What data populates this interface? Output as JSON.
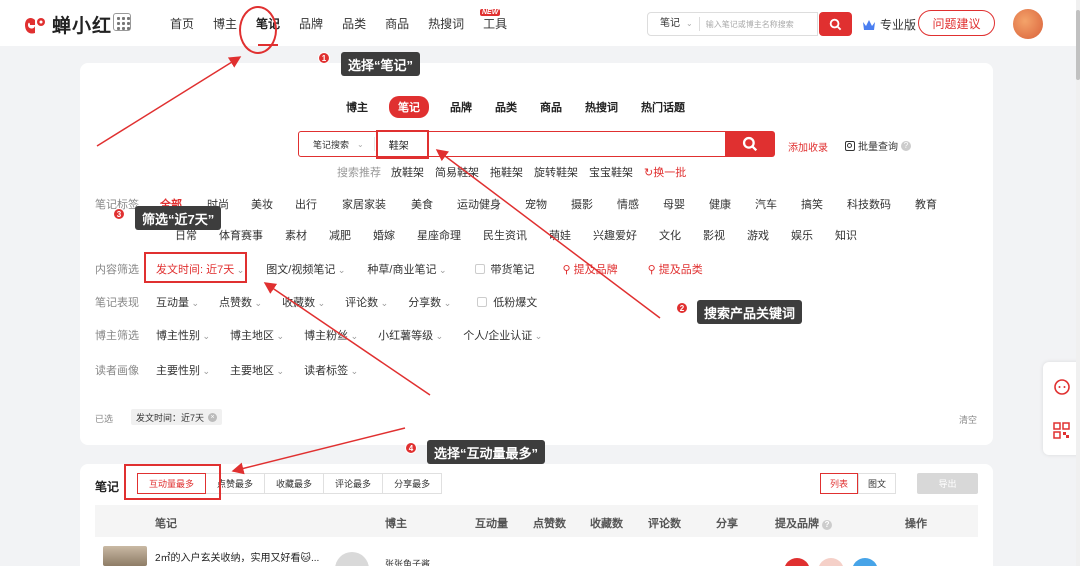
{
  "app": {
    "logo_text": "蝉小红"
  },
  "nav": {
    "links": [
      "首页",
      "博主",
      "笔记",
      "品牌",
      "品类",
      "商品",
      "热搜词",
      "工具"
    ],
    "new_badge": "NEW",
    "search_select": "笔记",
    "search_placeholder": "输入笔记或博主名称搜索",
    "pro_label": "专业版",
    "feedback_label": "问题建议"
  },
  "panel": {
    "tabs": [
      "博主",
      "笔记",
      "品牌",
      "品类",
      "商品",
      "热搜词",
      "热门话题"
    ],
    "search_select": "笔记搜索",
    "search_keyword": "鞋架",
    "add_fav": "添加收录",
    "batch_query": "批量查询",
    "recommend_label": "搜索推荐",
    "recommendations": [
      "放鞋架",
      "简易鞋架",
      "拖鞋架",
      "旋转鞋架",
      "宝宝鞋架"
    ],
    "refresh_label": "换一批",
    "tag_row_label": "笔记标签",
    "tags_row1": [
      "全部",
      "时尚",
      "美妆",
      "出行",
      "家居家装",
      "美食",
      "运动健身",
      "宠物",
      "摄影",
      "情感",
      "母婴",
      "健康",
      "汽车",
      "搞笑",
      "科技数码",
      "教育"
    ],
    "tags_row2": [
      "日常",
      "体育赛事",
      "素材",
      "减肥",
      "婚嫁",
      "星座命理",
      "民生资讯",
      "萌娃",
      "兴趣爱好",
      "文化",
      "影视",
      "游戏",
      "娱乐",
      "知识"
    ],
    "content_filter_label": "内容筛选",
    "content_filters": [
      "发文时间: 近7天",
      "图文/视频笔记",
      "种草/商业笔记",
      "带货笔记",
      "提及品牌",
      "提及品类"
    ],
    "note_perf_label": "笔记表现",
    "note_perf_filters": [
      "互动量",
      "点赞数",
      "收藏数",
      "评论数",
      "分享数",
      "低粉爆文"
    ],
    "blogger_filter_label": "博主筛选",
    "blogger_filters": [
      "博主性别",
      "博主地区",
      "博主粉丝",
      "小红薯等级",
      "个人/企业认证"
    ],
    "reader_label": "读者画像",
    "reader_filters": [
      "主要性别",
      "主要地区",
      "读者标签"
    ],
    "selected_label": "已选",
    "selected_tag": "发文时间：近7天",
    "clear_label": "清空"
  },
  "notes": {
    "title": "笔记",
    "sorts": [
      "互动量最多",
      "点赞最多",
      "收藏最多",
      "评论最多",
      "分享最多"
    ],
    "view_list": "列表",
    "view_card": "图文",
    "export": "导出",
    "columns": [
      "笔记",
      "博主",
      "互动量",
      "点赞数",
      "收藏数",
      "评论数",
      "分享",
      "提及品牌",
      "操作"
    ],
    "row1_title": "2㎡的入户玄关收纳，实用又好看🐱...",
    "row1_blogger": "张张鱼子酱"
  },
  "annotations": [
    {
      "num": "1",
      "text": "选择“笔记”"
    },
    {
      "num": "2",
      "text": "搜索产品关键词"
    },
    {
      "num": "3",
      "text": "筛选“近7天”"
    },
    {
      "num": "4",
      "text": "选择“互动量最多”"
    }
  ],
  "colors": {
    "accent": "#e03030",
    "callout_bg": "#3d3d3d"
  }
}
